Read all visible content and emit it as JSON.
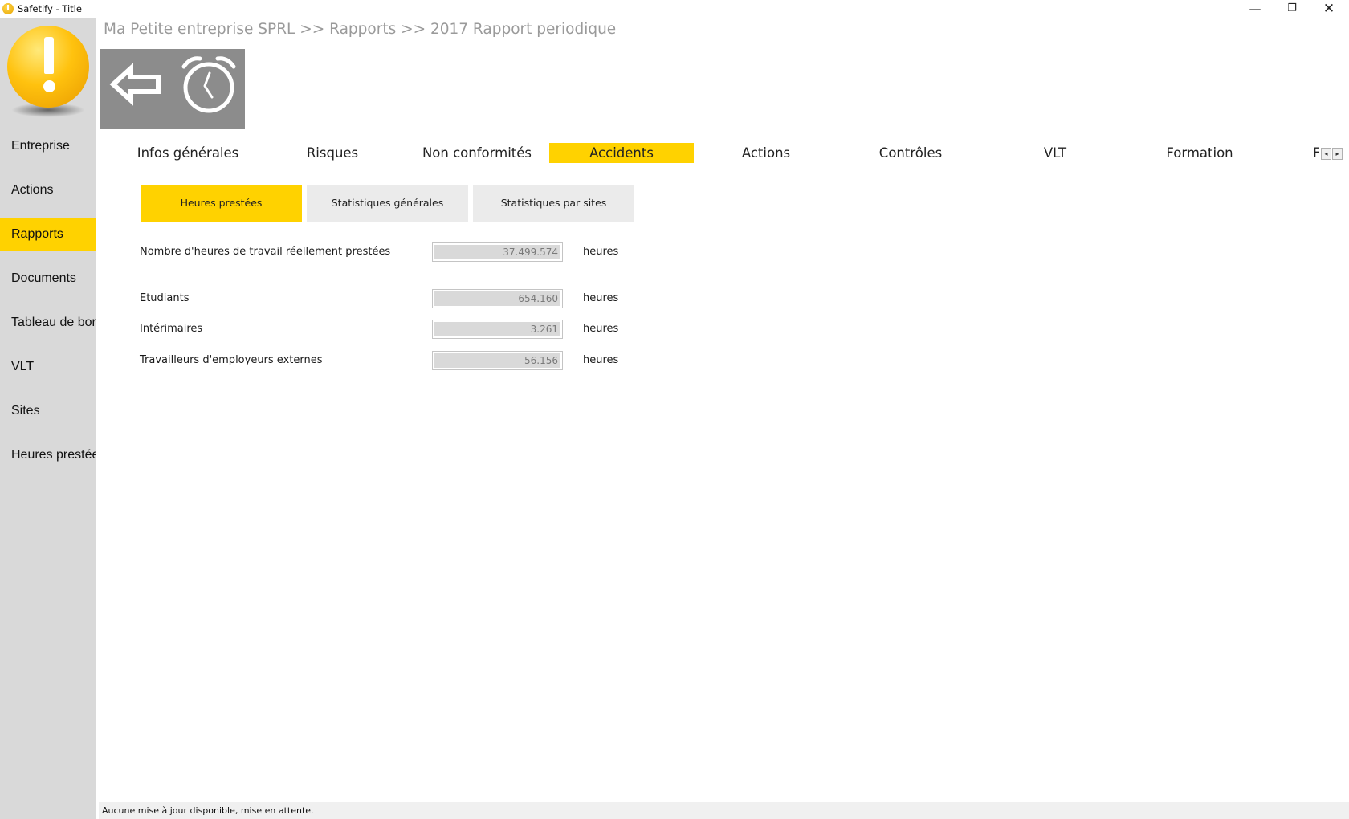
{
  "window": {
    "title": "Safetify - Title",
    "controls": {
      "minimize": "—",
      "maximize": "❐",
      "close": "✕"
    }
  },
  "sidebar": {
    "items": [
      {
        "label": "Entreprise"
      },
      {
        "label": "Actions"
      },
      {
        "label": "Rapports",
        "active": true
      },
      {
        "label": "Documents"
      },
      {
        "label": "Tableau de bord"
      },
      {
        "label": "VLT"
      },
      {
        "label": "Sites"
      },
      {
        "label": "Heures prestées"
      }
    ]
  },
  "breadcrumb": "Ma Petite entreprise SPRL >> Rapports >> 2017 Rapport periodique",
  "toolbar": {
    "back_icon": "back-arrow-icon",
    "clock_icon": "stopwatch-icon"
  },
  "tabs": [
    {
      "label": "Infos générales"
    },
    {
      "label": "Risques"
    },
    {
      "label": "Non conformités"
    },
    {
      "label": "Accidents",
      "active": true
    },
    {
      "label": "Actions"
    },
    {
      "label": "Contrôles"
    },
    {
      "label": "VLT"
    },
    {
      "label": "Formation"
    }
  ],
  "tabs_overflow": {
    "clipped_label": "F",
    "left_arrow": "◂",
    "right_arrow": "▸"
  },
  "subtabs": [
    {
      "label": "Heures prestées",
      "active": true
    },
    {
      "label": "Statistiques générales"
    },
    {
      "label": "Statistiques par sites"
    }
  ],
  "form": {
    "rows": [
      {
        "label": "Nombre d'heures de travail réellement prestées",
        "value": "37.499.574",
        "unit": "heures"
      },
      {
        "label": "Etudiants",
        "value": "654.160",
        "unit": "heures"
      },
      {
        "label": "Intérimaires",
        "value": "3.261",
        "unit": "heures"
      },
      {
        "label": "Travailleurs d'employeurs externes",
        "value": "56.156",
        "unit": "heures"
      }
    ]
  },
  "status": "Aucune mise à jour disponible, mise en attente.",
  "colors": {
    "accent": "#ffd200",
    "sidebar": "#d9d9d9",
    "toolbar": "#8c8c8c"
  }
}
